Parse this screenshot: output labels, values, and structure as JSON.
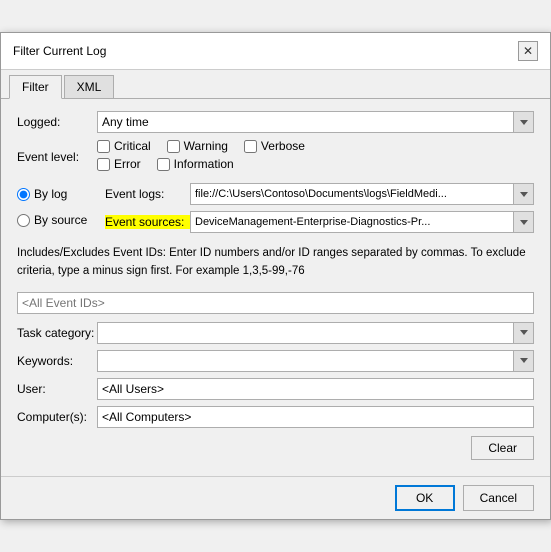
{
  "dialog": {
    "title": "Filter Current Log",
    "close_label": "✕"
  },
  "tabs": [
    {
      "label": "Filter",
      "active": true
    },
    {
      "label": "XML",
      "active": false
    }
  ],
  "form": {
    "logged_label": "Logged:",
    "logged_value": "Any time",
    "event_level_label": "Event level:",
    "checkboxes": [
      {
        "label": "Critical",
        "checked": false
      },
      {
        "label": "Warning",
        "checked": false
      },
      {
        "label": "Verbose",
        "checked": false
      },
      {
        "label": "Error",
        "checked": false
      },
      {
        "label": "Information",
        "checked": false
      }
    ],
    "radio_by_log_label": "By log",
    "radio_by_source_label": "By source",
    "event_logs_label": "Event logs:",
    "event_logs_value": "file://C:\\Users\\Contoso\\Documents\\logs\\FieldMedi...",
    "event_sources_label": "Event sources:",
    "event_sources_value": "DeviceManagement-Enterprise-Diagnostics-Pr...",
    "description": "Includes/Excludes Event IDs: Enter ID numbers and/or ID ranges separated by commas. To exclude criteria, type a minus sign first. For example 1,3,5-99,-76",
    "event_ids_placeholder": "<All Event IDs>",
    "task_category_label": "Task category:",
    "task_category_value": "",
    "keywords_label": "Keywords:",
    "keywords_value": "",
    "user_label": "User:",
    "user_value": "<All Users>",
    "computer_label": "Computer(s):",
    "computer_value": "<All Computers>",
    "clear_label": "Clear",
    "ok_label": "OK",
    "cancel_label": "Cancel"
  }
}
